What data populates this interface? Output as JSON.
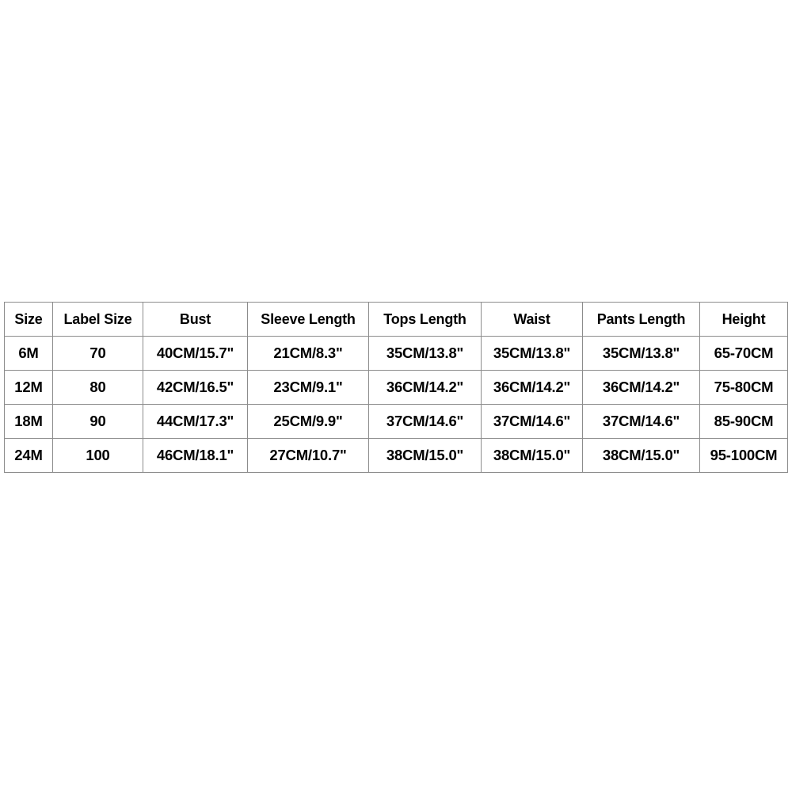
{
  "table": {
    "name": "size-chart",
    "headers": [
      "Size",
      "Label Size",
      "Bust",
      "Sleeve Length",
      "Tops Length",
      "Waist",
      "Pants Length",
      "Height"
    ],
    "rows": [
      {
        "size": "6M",
        "label_size": "70",
        "bust": "40CM/15.7\"",
        "sleeve_length": "21CM/8.3\"",
        "tops_length": "35CM/13.8\"",
        "waist": "35CM/13.8\"",
        "pants_length": "35CM/13.8\"",
        "height": "65-70CM"
      },
      {
        "size": "12M",
        "label_size": "80",
        "bust": "42CM/16.5\"",
        "sleeve_length": "23CM/9.1\"",
        "tops_length": "36CM/14.2\"",
        "waist": "36CM/14.2\"",
        "pants_length": "36CM/14.2\"",
        "height": "75-80CM"
      },
      {
        "size": "18M",
        "label_size": "90",
        "bust": "44CM/17.3\"",
        "sleeve_length": "25CM/9.9\"",
        "tops_length": "37CM/14.6\"",
        "waist": "37CM/14.6\"",
        "pants_length": "37CM/14.6\"",
        "height": "85-90CM"
      },
      {
        "size": "24M",
        "label_size": "100",
        "bust": "46CM/18.1\"",
        "sleeve_length": "27CM/10.7\"",
        "tops_length": "38CM/15.0\"",
        "waist": "38CM/15.0\"",
        "pants_length": "38CM/15.0\"",
        "height": "95-100CM"
      }
    ]
  },
  "colors": {
    "background": "#ffffff",
    "border": "#8c8c8c",
    "text": "#000000"
  }
}
